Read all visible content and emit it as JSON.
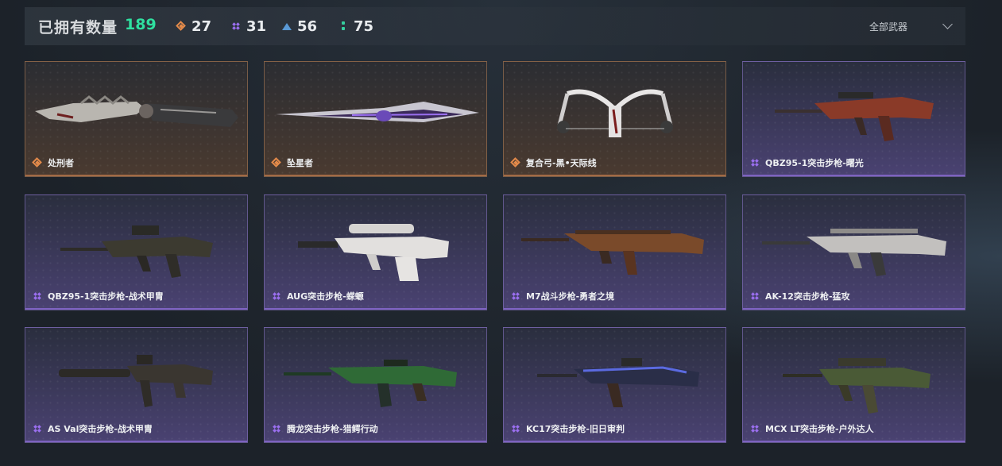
{
  "summary": {
    "owned_label": "已拥有数量",
    "owned_count": "189",
    "rarities": [
      {
        "icon": "orange-diamond-icon",
        "count": "27",
        "color": "#e38a4a"
      },
      {
        "icon": "purple-cluster-icon",
        "count": "31",
        "color": "#9b6ff0"
      },
      {
        "icon": "blue-triangle-icon",
        "count": "56",
        "color": "#5a9ad6"
      },
      {
        "icon": "green-dots-icon",
        "count": "75",
        "color": "#35d0a0"
      }
    ]
  },
  "filter": {
    "label": "全部武器"
  },
  "weapons": [
    {
      "name": "处刑者",
      "rarity": "orange"
    },
    {
      "name": "坠星者",
      "rarity": "orange"
    },
    {
      "name": "复合弓-黑•天际线",
      "rarity": "orange"
    },
    {
      "name": "QBZ95-1突击步枪-曙光",
      "rarity": "purple"
    },
    {
      "name": "QBZ95-1突击步枪-战术甲胄",
      "rarity": "purple"
    },
    {
      "name": "AUG突击步枪-蝾螈",
      "rarity": "purple"
    },
    {
      "name": "M7战斗步枪-勇者之境",
      "rarity": "purple"
    },
    {
      "name": "AK-12突击步枪-猛攻",
      "rarity": "purple"
    },
    {
      "name": "AS Val突击步枪-战术甲胄",
      "rarity": "purple"
    },
    {
      "name": "腾龙突击步枪-猎鳄行动",
      "rarity": "purple"
    },
    {
      "name": "KC17突击步枪-旧日审判",
      "rarity": "purple"
    },
    {
      "name": "MCX LT突击步枪-户外达人",
      "rarity": "purple"
    }
  ]
}
